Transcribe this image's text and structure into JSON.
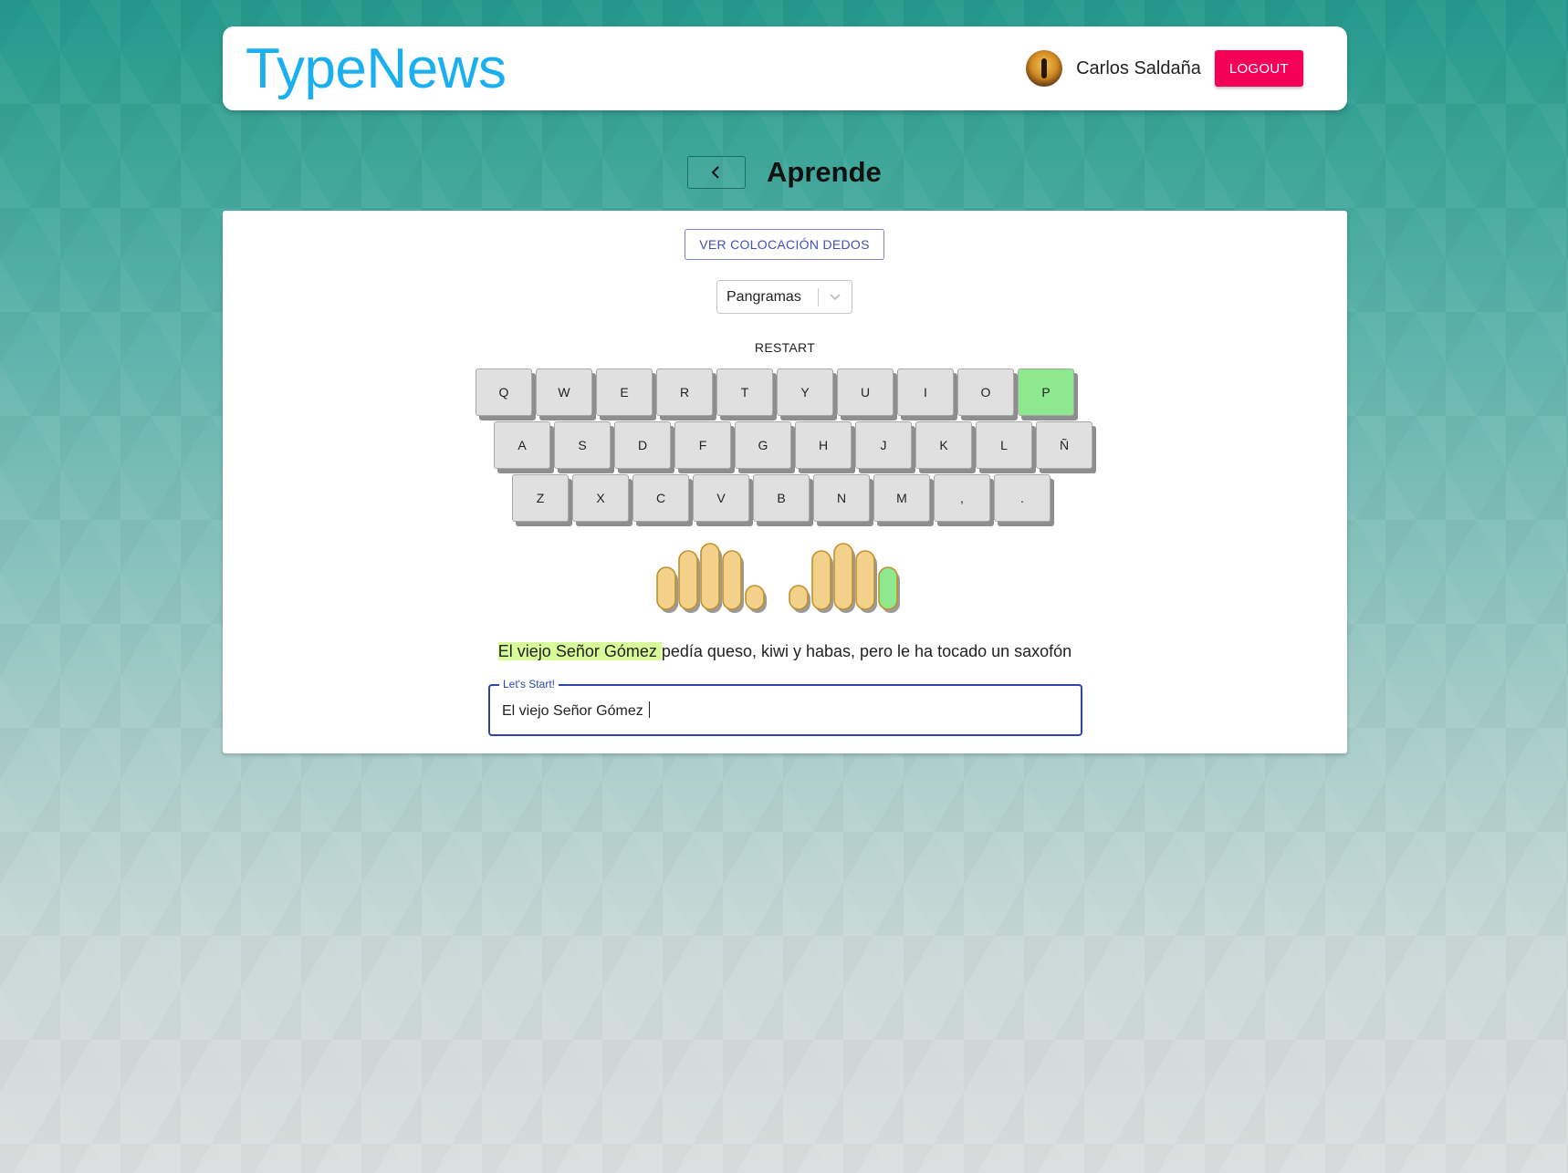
{
  "header": {
    "logo": "TypeNews",
    "user_name": "Carlos Saldaña",
    "logout_label": "LOGOUT"
  },
  "page": {
    "title": "Aprende"
  },
  "controls": {
    "finger_placement_label": "VER COLOCACIÓN DEDOS",
    "mode_selected": "Pangramas",
    "restart_label": "RESTART"
  },
  "keyboard": {
    "row1": [
      "Q",
      "W",
      "E",
      "R",
      "T",
      "Y",
      "U",
      "I",
      "O",
      "P"
    ],
    "row2": [
      "A",
      "S",
      "D",
      "F",
      "G",
      "H",
      "J",
      "K",
      "L",
      "Ñ"
    ],
    "row3": [
      "Z",
      "X",
      "C",
      "V",
      "B",
      "N",
      "M",
      ",",
      "."
    ],
    "active_key": "P",
    "active_color": "#8ee98e"
  },
  "hands": {
    "active_finger": "right-pinky",
    "finger_color": "#f3d18a",
    "active_finger_color": "#8ee98e"
  },
  "exercise": {
    "typed_text": "El viejo Señor Gómez ",
    "remaining_text": "pedía queso, kiwi y habas, pero le ha tocado un saxofón",
    "input_label": "Let's Start!",
    "input_value": "El viejo Señor Gómez "
  },
  "colors": {
    "logo": "#1ab0f0",
    "logout": "#f50057",
    "primary": "#3f51b5",
    "highlight": "#d8fb9a"
  }
}
